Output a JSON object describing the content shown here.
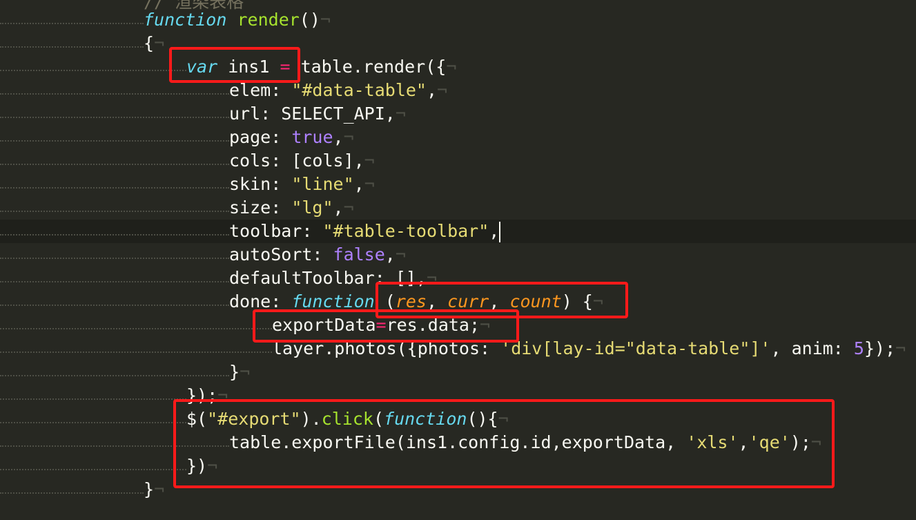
{
  "editor": {
    "lines": [
      {
        "parts": [
          [
            "comment",
            "// 渲染表格"
          ]
        ]
      },
      {
        "parts": [
          [
            "kw",
            "function"
          ],
          [
            "plain",
            " "
          ],
          [
            "fn",
            "render"
          ],
          [
            "plain",
            "()"
          ]
        ]
      },
      {
        "parts": [
          [
            "plain",
            "{"
          ]
        ]
      },
      {
        "parts": [
          [
            "kw",
            "var"
          ],
          [
            "plain",
            " ins1 "
          ],
          [
            "op",
            "="
          ],
          [
            "plain",
            " table.render({"
          ]
        ]
      },
      {
        "parts": [
          [
            "plain",
            "elem: "
          ],
          [
            "str",
            "\"#data-table\""
          ],
          [
            "plain",
            ","
          ]
        ]
      },
      {
        "parts": [
          [
            "plain",
            "url: SELECT_API,"
          ]
        ]
      },
      {
        "parts": [
          [
            "plain",
            "page: "
          ],
          [
            "bool",
            "true"
          ],
          [
            "plain",
            ","
          ]
        ]
      },
      {
        "parts": [
          [
            "plain",
            "cols: [cols],"
          ]
        ]
      },
      {
        "parts": [
          [
            "plain",
            "skin: "
          ],
          [
            "str",
            "\"line\""
          ],
          [
            "plain",
            ","
          ]
        ]
      },
      {
        "parts": [
          [
            "plain",
            "size: "
          ],
          [
            "str",
            "\"lg\""
          ],
          [
            "plain",
            ","
          ]
        ]
      },
      {
        "parts": [
          [
            "plain",
            "toolbar: "
          ],
          [
            "str",
            "\"#table-toolbar\""
          ],
          [
            "plain",
            ","
          ]
        ]
      },
      {
        "parts": [
          [
            "plain",
            "autoSort: "
          ],
          [
            "bool",
            "false"
          ],
          [
            "plain",
            ","
          ]
        ]
      },
      {
        "parts": [
          [
            "plain",
            "defaultToolbar: [],"
          ]
        ]
      },
      {
        "parts": [
          [
            "plain",
            "done: "
          ],
          [
            "kw",
            "function"
          ],
          [
            "plain",
            " ("
          ],
          [
            "param",
            "res"
          ],
          [
            "plain",
            ", "
          ],
          [
            "param",
            "curr"
          ],
          [
            "plain",
            ", "
          ],
          [
            "param",
            "count"
          ],
          [
            "plain",
            ") {"
          ]
        ]
      },
      {
        "parts": [
          [
            "plain",
            "exportData"
          ],
          [
            "op",
            "="
          ],
          [
            "plain",
            "res.data;"
          ]
        ]
      },
      {
        "parts": [
          [
            "plain",
            "layer.photos({photos: "
          ],
          [
            "str",
            "'div[lay-id=\"data-table\"]'"
          ],
          [
            "plain",
            ", anim: "
          ],
          [
            "num",
            "5"
          ],
          [
            "plain",
            "});"
          ]
        ]
      },
      {
        "parts": [
          [
            "plain",
            "}"
          ]
        ]
      },
      {
        "parts": [
          [
            "plain",
            "});"
          ]
        ]
      },
      {
        "parts": [
          [
            "plain",
            "$("
          ],
          [
            "str",
            "\"#export\""
          ],
          [
            "plain",
            ")."
          ],
          [
            "fn",
            "click"
          ],
          [
            "plain",
            "("
          ],
          [
            "kw",
            "function"
          ],
          [
            "plain",
            "(){"
          ]
        ]
      },
      {
        "parts": [
          [
            "plain",
            "table.exportFile(ins1.config.id,exportData, "
          ],
          [
            "str",
            "'xls'"
          ],
          [
            "plain",
            ","
          ],
          [
            "str",
            "'qe'"
          ],
          [
            "plain",
            ");"
          ]
        ]
      },
      {
        "parts": [
          [
            "plain",
            "})"
          ]
        ]
      },
      {
        "parts": [
          [
            "plain",
            "}"
          ]
        ]
      }
    ],
    "pilcrow": "¬"
  },
  "colors": {
    "background": "#272822",
    "highlight_box": "#ff1a1a",
    "keyword": "#66d9ef",
    "string": "#e6db74",
    "function_name": "#a6e22e",
    "constant": "#ae81ff",
    "operator": "#f92672",
    "parameter": "#fd971f"
  }
}
